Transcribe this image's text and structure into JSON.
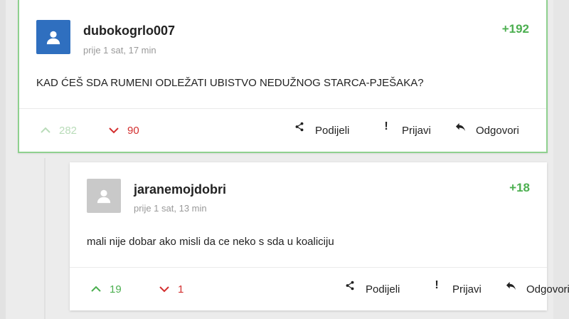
{
  "comments": [
    {
      "username": "dubokogrlo007",
      "timestamp": "prije 1 sat, 17 min",
      "score": "+192",
      "text": "KAD ĆEŠ SDA RUMENI ODLEŽATI UBISTVO NEDUŽNOG STARCA-PJEŠAKA?",
      "upvotes": "282",
      "downvotes": "90",
      "avatar_color": "#2f6fbf"
    },
    {
      "username": "jaranemojdobri",
      "timestamp": "prije 1 sat, 13 min",
      "score": "+18",
      "text": "mali nije dobar ako misli da ce neko s sda u koaliciju",
      "upvotes": "19",
      "downvotes": "1",
      "avatar_color": "#c9c9c9"
    }
  ],
  "actions": {
    "share_label": "Podijeli",
    "report_label": "Prijavi",
    "reply_label": "Odgovori"
  },
  "colors": {
    "positive": "#4caf50",
    "negative": "#d32f2f",
    "highlight_border": "#8fd08f"
  },
  "icons": [
    "user-icon",
    "upvote-chevron-icon",
    "downvote-chevron-icon",
    "share-icon",
    "report-icon",
    "reply-icon"
  ]
}
